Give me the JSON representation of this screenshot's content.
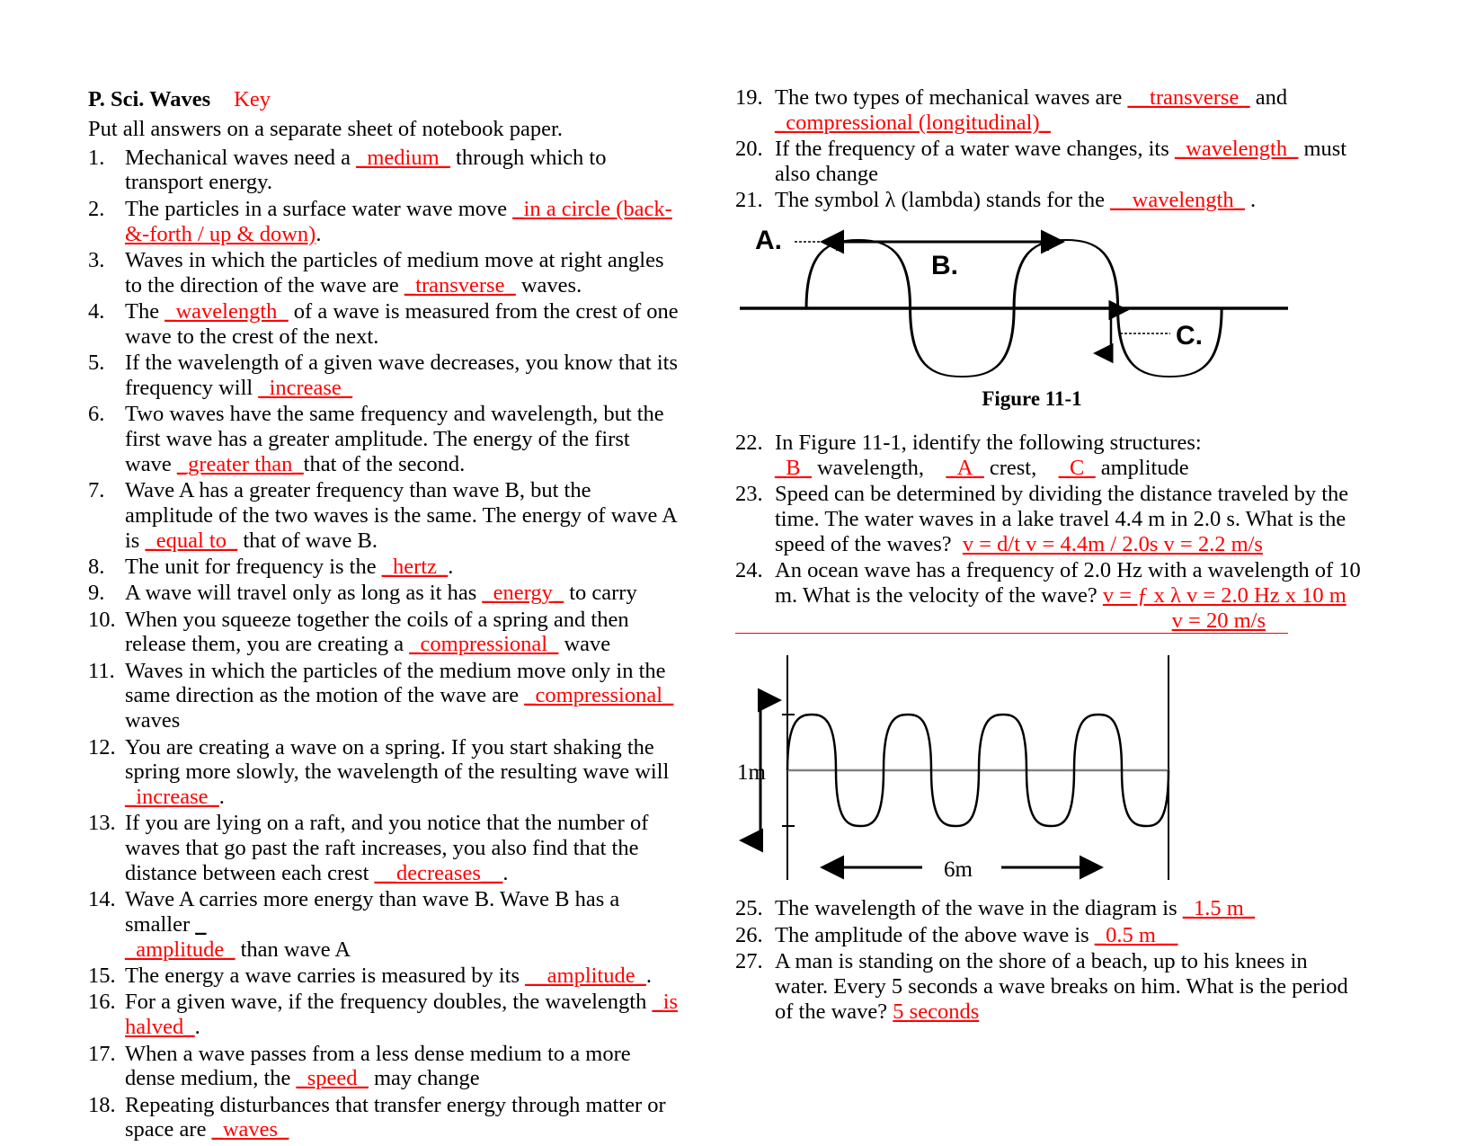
{
  "header": {
    "title_main": "P. Sci.  Waves",
    "title_key": "Key",
    "subtitle": "Put all answers on a separate sheet of notebook paper."
  },
  "left_column": {
    "items": [
      {
        "num": "1.",
        "pre": "Mechanical waves need a",
        "ans": "_medium_",
        "post": "through which to transport energy."
      },
      {
        "num": "2.",
        "pre": "The particles in a surface water wave move",
        "ans": "_in a circle (back-&-forth / up & down)",
        "post": "."
      },
      {
        "num": "3.",
        "pre": "Waves in which the particles of medium move at right angles to the direction of the wave are",
        "ans": "_transverse_",
        "post": "waves."
      },
      {
        "num": "4.",
        "pre": "The",
        "ans": "_wavelength_",
        "post": "of a wave is measured from the crest of one wave to the crest of the next."
      },
      {
        "num": "5.",
        "pre": "If the wavelength of a given wave decreases, you know that its frequency will",
        "ans": "_increase_",
        "post": ""
      },
      {
        "num": "6.",
        "pre": "Two waves have the same frequency and wavelength, but the first wave has a greater amplitude. The energy of the first wave",
        "ans": "_greater than_",
        "post": "that of the second."
      },
      {
        "num": "7.",
        "pre": "Wave A has a greater frequency than wave B, but the amplitude of the two waves is the same. The energy of wave A is",
        "ans": "_equal to_",
        "post": "that of wave B."
      },
      {
        "num": "8.",
        "pre": "The unit for frequency is the",
        "ans": "_hertz_",
        "post": "."
      },
      {
        "num": "9.",
        "pre": "A wave will travel only as long as it has",
        "ans": "_energy_",
        "post": "to carry"
      },
      {
        "num": "10.",
        "pre": "When you squeeze together the coils of a spring and then release them, you are creating a",
        "ans": "_compressional_",
        "post": "wave"
      },
      {
        "num": "11.",
        "pre": "Waves in which the particles of the medium move only in the same direction as the motion of the wave are",
        "ans": "_compressional_",
        "post": "waves"
      },
      {
        "num": "12.",
        "pre": "You are creating a wave on a spring. If you start shaking the spring more slowly, the wavelength of the resulting wave will",
        "ans": "_increase_",
        "post": "."
      },
      {
        "num": "13.",
        "pre": "If you are lying on a raft, and you notice that the number of waves that go past the raft increases, you also find that the distance between each crest",
        "ans": "__decreases__",
        "post": "."
      },
      {
        "num": "14.",
        "pre": "Wave A carries more energy than wave B. Wave B has a smaller",
        "ans": "_amplitude_",
        "post": "than wave A"
      },
      {
        "num": "15.",
        "pre": "The energy a wave carries is measured by its",
        "ans": "__amplitude_",
        "post": "."
      },
      {
        "num": "16.",
        "pre": "For a given wave, if the frequency doubles, the wavelength",
        "ans": "_is halved_",
        "post": "."
      },
      {
        "num": "17.",
        "pre": "When a wave passes from a less dense medium to a more dense medium, the",
        "ans": "_speed_",
        "post": "may change"
      },
      {
        "num": "18.",
        "pre": "Repeating disturbances that transfer energy through matter or space are",
        "ans": "_waves_",
        "post": ""
      }
    ]
  },
  "right_column": {
    "items_top": [
      {
        "num": "19.",
        "pre": "The two types of mechanical waves are",
        "ans": "__transverse_",
        "mid": "and",
        "ans2": "_compressional (longitudinal)_",
        "post": ""
      },
      {
        "num": "20.",
        "pre": "If the frequency of a water wave changes, its",
        "ans": "_wavelength_",
        "post": "must also change"
      },
      {
        "num": "21.",
        "pre": "The symbol λ (lambda) stands for the",
        "ans": "__wavelength_",
        "post": "."
      }
    ],
    "figure1": {
      "caption": "Figure 11-1",
      "labels": {
        "a": "A.",
        "b": "B.",
        "c": "C."
      }
    },
    "items_mid": [
      {
        "num": "22.",
        "line1": "In Figure 11-1, identify the following structures:",
        "parts": [
          {
            "ans": "_B_",
            "label": "wavelength,"
          },
          {
            "ans": "_A_",
            "label": "crest,"
          },
          {
            "ans": "_C_",
            "label": "amplitude"
          }
        ]
      },
      {
        "num": "23.",
        "pre": "Speed can be determined by dividing the distance traveled by the time. The water waves in a lake travel 4.4 m in 2.0 s. What is the speed of the waves?",
        "work": "v = d/t      v = 4.4m / 2.0s   v = 2.2 m/s"
      },
      {
        "num": "24.",
        "pre": "An ocean wave has a frequency of 2.0 Hz with a wavelength of 10 m. What is the velocity of the wave?",
        "work": "v = ƒ x λ   v = 2.0 Hz x 10 m",
        "work2": "v = 20 m/s"
      }
    ],
    "figure2": {
      "y_label": "1m",
      "x_label": "6m"
    },
    "items_bottom": [
      {
        "num": "25.",
        "pre": "The wavelength of the wave in the diagram is",
        "ans": "_1.5 m_",
        "post": ""
      },
      {
        "num": "26.",
        "pre": "The amplitude of the above wave is",
        "ans": "_0.5 m__",
        "post": ""
      },
      {
        "num": "27.",
        "pre": "A man is standing on the shore of a beach, up to his knees in water. Every 5 seconds a wave breaks on him. What is the period of the wave?",
        "ans": "5 seconds",
        "post": ""
      }
    ]
  },
  "colors": {
    "answer_red": "#ff0000",
    "text_black": "#000000",
    "paper": "#ffffff"
  }
}
